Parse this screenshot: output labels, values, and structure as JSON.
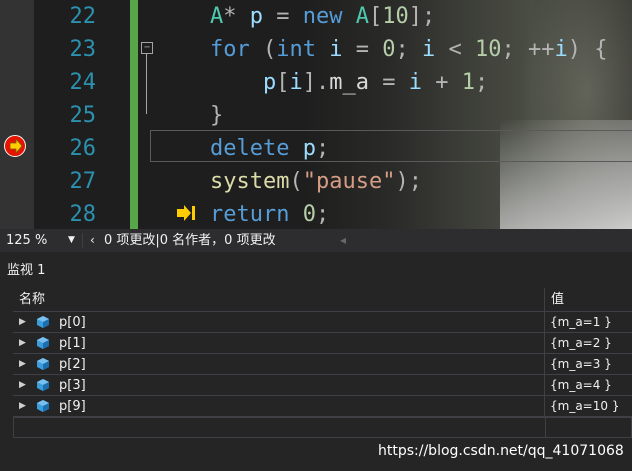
{
  "editor": {
    "lines": [
      {
        "num": "22",
        "tokens": [
          [
            "ty",
            "A"
          ],
          [
            "op",
            "* "
          ],
          [
            "var",
            "p"
          ],
          [
            "op",
            " = "
          ],
          [
            "kw",
            "new"
          ],
          [
            "op",
            " "
          ],
          [
            "ty",
            "A"
          ],
          [
            "op",
            "["
          ],
          [
            "num",
            "10"
          ],
          [
            "op",
            "];"
          ]
        ]
      },
      {
        "num": "23",
        "tokens": [
          [
            "kw",
            "for"
          ],
          [
            "op",
            " ("
          ],
          [
            "kw",
            "int"
          ],
          [
            "op",
            " "
          ],
          [
            "var",
            "i"
          ],
          [
            "op",
            " = "
          ],
          [
            "num",
            "0"
          ],
          [
            "op",
            "; "
          ],
          [
            "var",
            "i"
          ],
          [
            "op",
            " < "
          ],
          [
            "num",
            "10"
          ],
          [
            "op",
            "; ++"
          ],
          [
            "var",
            "i"
          ],
          [
            "op",
            ") {"
          ]
        ]
      },
      {
        "num": "24",
        "tokens": [
          [
            "op",
            "    "
          ],
          [
            "var",
            "p"
          ],
          [
            "op",
            "["
          ],
          [
            "var",
            "i"
          ],
          [
            "op",
            "]."
          ],
          [
            "mem",
            "m_a"
          ],
          [
            "op",
            " = "
          ],
          [
            "var",
            "i"
          ],
          [
            "op",
            " + "
          ],
          [
            "num",
            "1"
          ],
          [
            "op",
            ";"
          ]
        ]
      },
      {
        "num": "25",
        "tokens": [
          [
            "op",
            "}"
          ]
        ]
      },
      {
        "num": "26",
        "tokens": [
          [
            "kw",
            "delete"
          ],
          [
            "op",
            " "
          ],
          [
            "var",
            "p"
          ],
          [
            "op",
            ";"
          ]
        ]
      },
      {
        "num": "27",
        "tokens": [
          [
            "fn",
            "system"
          ],
          [
            "op",
            "("
          ],
          [
            "str",
            "\"pause\""
          ],
          [
            "op",
            ");"
          ]
        ]
      },
      {
        "num": "28",
        "tokens": [
          [
            "kw",
            "return"
          ],
          [
            "op",
            " "
          ],
          [
            "num",
            "0"
          ],
          [
            "op",
            ";"
          ]
        ]
      }
    ],
    "fold_glyph": "−"
  },
  "statusbar": {
    "zoom": "125 %",
    "changes": "0 项更改|0 名作者，0 项更改"
  },
  "watch": {
    "title": "监视 1",
    "col_name": "名称",
    "col_value": "值",
    "rows": [
      {
        "name": "p[0]",
        "value": "{m_a=1 }"
      },
      {
        "name": "p[1]",
        "value": "{m_a=2 }"
      },
      {
        "name": "p[2]",
        "value": "{m_a=3 }"
      },
      {
        "name": "p[3]",
        "value": "{m_a=4 }"
      },
      {
        "name": "p[9]",
        "value": "{m_a=10 }"
      }
    ]
  },
  "watermark": "https://blog.csdn.net/qq_41071068",
  "colors": {
    "breakpoint": "#e51400",
    "line_number": "#2b91af",
    "change_bar": "#57a64a",
    "keyword": "#569cd6",
    "type": "#4ec9b0"
  }
}
